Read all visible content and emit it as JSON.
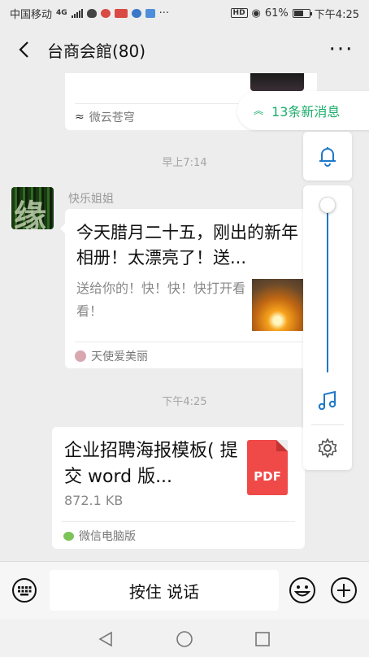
{
  "statusbar": {
    "carrier": "中国移动",
    "network": "4G",
    "battery": "61%",
    "time": "下午4:25",
    "hd": "HD"
  },
  "header": {
    "title": "台商会館(80)"
  },
  "new_messages": {
    "label": "13条新消息"
  },
  "messages": [
    {
      "source": "微云苍穹"
    },
    {
      "time": "早上7:14"
    },
    {
      "sender": "快乐姐姐",
      "title": "今天腊月二十五，刚出的新年相册！太漂亮了！送...",
      "desc": "送给你的！快！快！快打开看看！",
      "source": "天使爱美丽"
    },
    {
      "time": "下午4:25"
    },
    {
      "file_title": "企业招聘海报模板( 提交 word 版...",
      "file_size": "872.1 KB",
      "file_badge": "PDF",
      "source": "微信电脑版"
    }
  ],
  "volume_level": 0.97,
  "input": {
    "talk_label": "按住 说话"
  },
  "colors": {
    "accent_green": "#1aad6a",
    "accent_blue": "#1f78c9",
    "pdf_red": "#ef4a48"
  }
}
